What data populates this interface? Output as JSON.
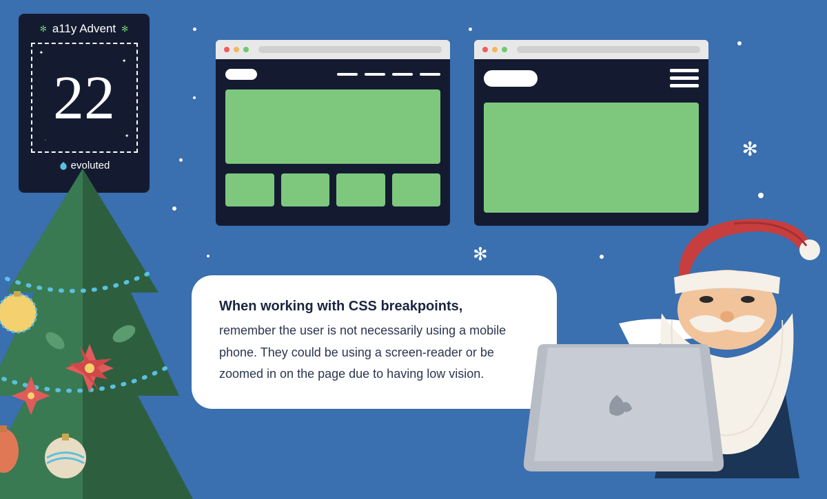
{
  "advent": {
    "title": "a11y Advent",
    "day": "22",
    "brand": "evoluted"
  },
  "speech": {
    "bold": "When working with CSS breakpoints,",
    "body": "remember the user is not necessarily using a mobile phone. They could be using a screen-reader or be zoomed in on the page due to having low vision."
  }
}
